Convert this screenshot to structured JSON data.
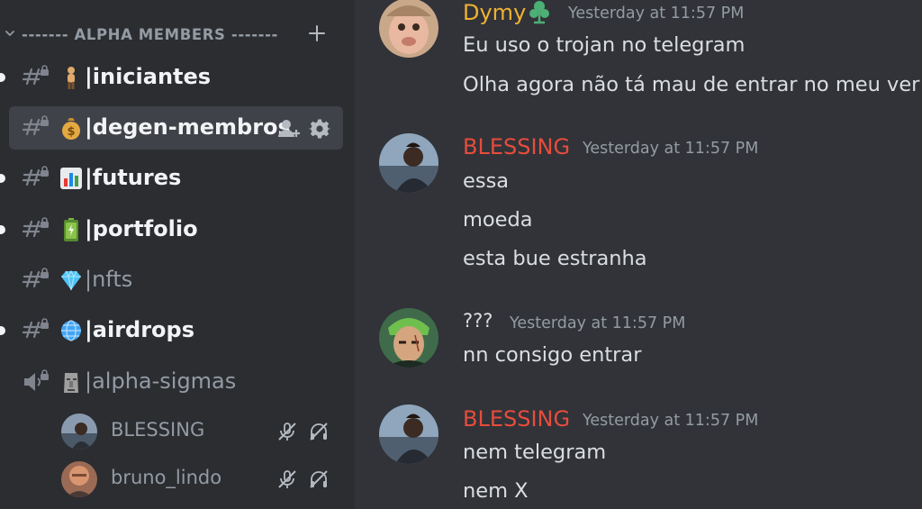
{
  "sidebar": {
    "category": {
      "name": "------- ALPHA MEMBERS -------",
      "chevron_icon": "chevron-down-icon",
      "add_icon": "plus-icon"
    },
    "channels": [
      {
        "emoji": "🧍",
        "name": "|iniciantes",
        "unread": true,
        "selected": false
      },
      {
        "emoji": "💰",
        "name": "|degen-membros",
        "unread": false,
        "selected": true,
        "actions": [
          "invite-member-icon",
          "gear-icon"
        ]
      },
      {
        "emoji": "📊",
        "name": "|futures",
        "unread": true,
        "selected": false
      },
      {
        "emoji": "🔋",
        "name": "|portfolio",
        "unread": true,
        "selected": false
      },
      {
        "emoji": "💎",
        "name": "|nfts",
        "unread": false,
        "selected": false
      },
      {
        "emoji": "🌐",
        "name": "|airdrops",
        "unread": true,
        "selected": false
      },
      {
        "emoji": "🗿",
        "name": "|alpha-sigmas",
        "unread": false,
        "selected": false,
        "type": "voice"
      }
    ],
    "voice_users": [
      {
        "name": "BLESSING",
        "status_icons": [
          "mic-muted-icon",
          "deafened-icon"
        ]
      },
      {
        "name": "bruno_lindo",
        "status_icons": [
          "mic-muted-icon",
          "deafened-icon"
        ]
      }
    ]
  },
  "messages": [
    {
      "author": "Dymy",
      "author_color": "#f0b232",
      "badge": "green-sprout-badge-icon",
      "timestamp": "Yesterday at 11:57 PM",
      "lines": [
        "Eu uso o trojan no telegram",
        "Olha agora não tá mau de entrar no meu ver"
      ]
    },
    {
      "author": "BLESSING",
      "author_color": "#e74c3c",
      "timestamp": "Yesterday at 11:57 PM",
      "lines": [
        "essa",
        "moeda",
        "esta bue estranha"
      ]
    },
    {
      "author": "???",
      "author_color": "#dbdee1",
      "timestamp": "Yesterday at 11:57 PM",
      "lines": [
        "nn consigo entrar"
      ]
    },
    {
      "author": "BLESSING",
      "author_color": "#e74c3c",
      "timestamp": "Yesterday at 11:57 PM",
      "lines": [
        "nem telegram",
        "nem X"
      ]
    }
  ],
  "colors": {
    "sidebar_bg": "#2b2d31",
    "chat_bg": "#313338",
    "selected_bg": "#404249",
    "muted_text": "#949ba4",
    "bright_text": "#f2f3f5"
  }
}
